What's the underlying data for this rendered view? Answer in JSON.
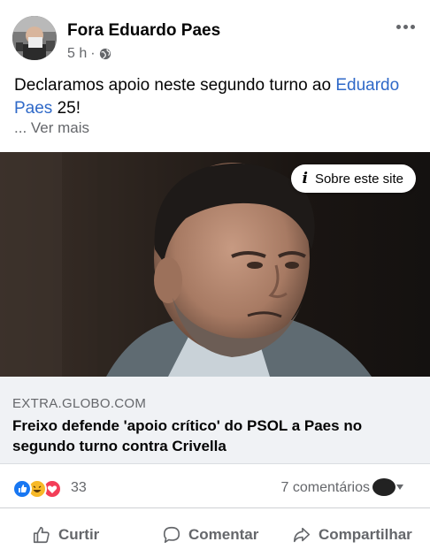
{
  "post": {
    "author": "Fora Eduardo Paes",
    "time": "5 h",
    "separator": "·",
    "text_before": "Declaramos apoio neste segundo turno ao ",
    "mention": "Eduardo Paes",
    "text_after": " 25!",
    "see_more": "... Ver mais"
  },
  "link_preview": {
    "about_label": "Sobre este site",
    "domain": "EXTRA.GLOBO.COM",
    "headline": "Freixo defende 'apoio crítico' do PSOL a Paes no segundo turno contra Crivella"
  },
  "reactions": {
    "count": "33",
    "comments": "7 comentários"
  },
  "actions": {
    "like": "Curtir",
    "comment": "Comentar",
    "share": "Compartilhar"
  },
  "colors": {
    "link": "#2f69c8",
    "like_reaction": "#1877f2",
    "haha_reaction": "#f7b928",
    "love_reaction": "#f33e58"
  },
  "icons": [
    "globe-icon",
    "more-options-icon",
    "info-icon",
    "like-icon",
    "comment-icon",
    "share-icon"
  ]
}
